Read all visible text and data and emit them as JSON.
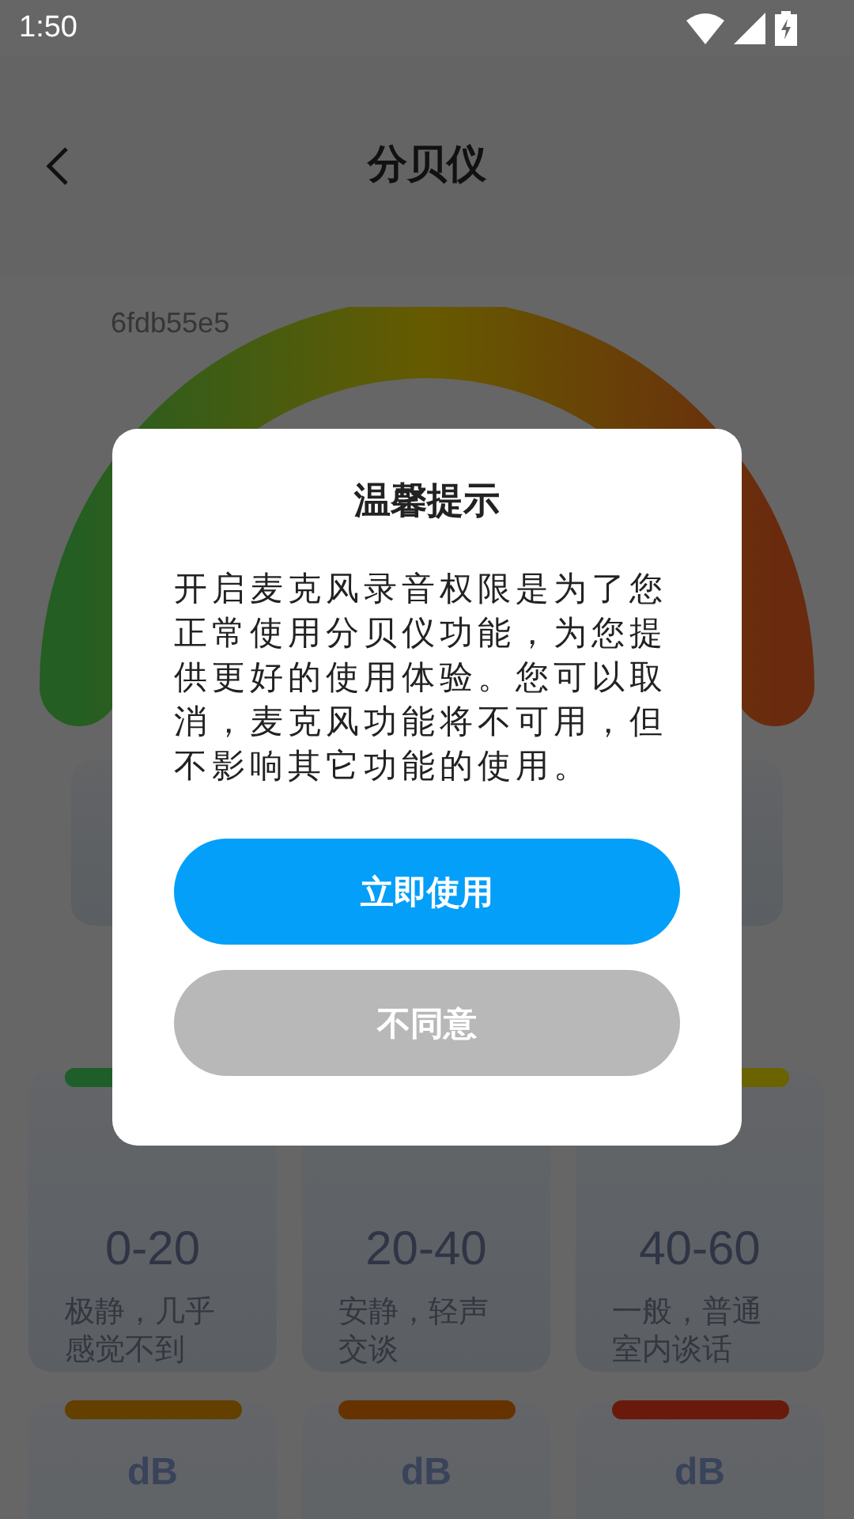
{
  "status_bar": {
    "time": "1:50"
  },
  "header": {
    "title": "分贝仪"
  },
  "gauge": {
    "label": "6fdb55e5"
  },
  "level_cards": [
    {
      "color": "#1e5e28",
      "range": "0-20",
      "description": "极静，几乎感觉不到"
    },
    {
      "range": "20-40",
      "description": "安静，轻声交谈"
    },
    {
      "color": "#6b6300",
      "range": "40-60",
      "description": "一般，普通室内谈话"
    },
    {
      "color": "#633f00",
      "unit": "dB"
    },
    {
      "color": "#663300",
      "unit": "dB"
    },
    {
      "color": "#6a1a0a",
      "unit": "dB"
    }
  ],
  "dialog": {
    "title": "温馨提示",
    "message": "开启麦克风录音权限是为了您正常使用分贝仪功能，为您提供更好的使用体验。您可以取消，麦克风功能将不可用，但不影响其它功能的使用。",
    "buttons": [
      {
        "kind": "primary",
        "label": "立即使用"
      },
      {
        "kind": "secondary",
        "label": "不同意"
      }
    ]
  }
}
